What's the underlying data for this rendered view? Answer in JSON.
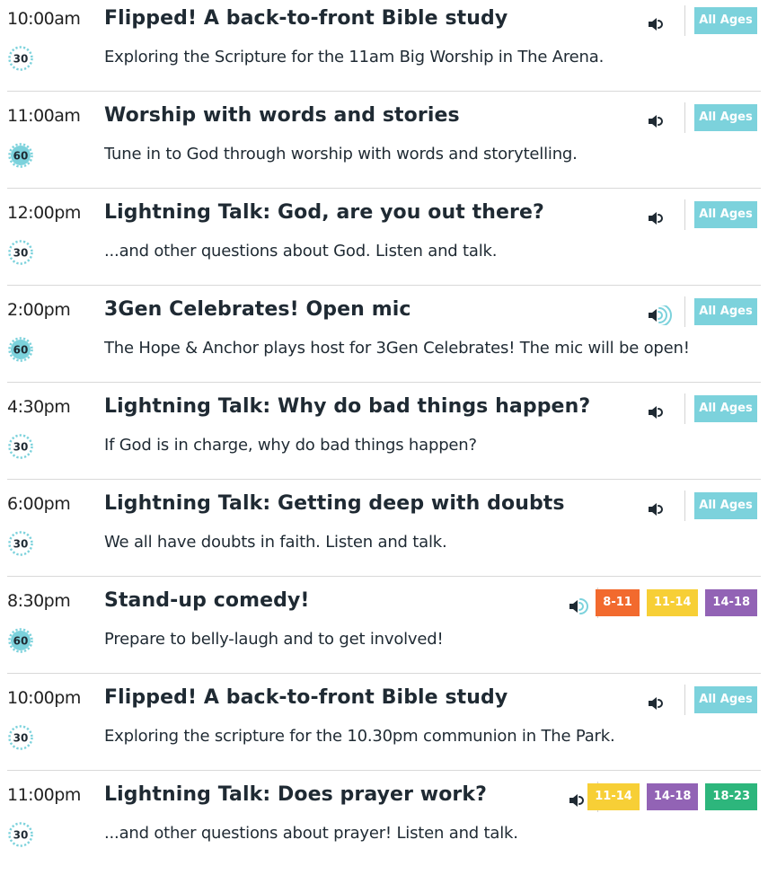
{
  "colors": {
    "all_ages": "#7cd2dc",
    "8-11": "#f26a2e",
    "11-14": "#f7cf36",
    "14-18": "#9263b5",
    "18-23": "#2db67c",
    "duration_badge": "#7cd2dc"
  },
  "events": [
    {
      "time": "10:00am",
      "title": "Flipped! A back-to-front Bible study",
      "description": "Exploring the Scripture for the 11am Big Worship in The Arena.",
      "duration": "30",
      "volume_icon": "volume-low-icon",
      "badges": [
        {
          "label": "All Ages",
          "color": "#7cd2dc"
        }
      ]
    },
    {
      "time": "11:00am",
      "title": "Worship with words and stories",
      "description": "Tune in to God through worship with words and storytelling.",
      "duration": "60",
      "volume_icon": "volume-low-icon",
      "badges": [
        {
          "label": "All Ages",
          "color": "#7cd2dc"
        }
      ]
    },
    {
      "time": "12:00pm",
      "title": "Lightning Talk: God, are you out there?",
      "description": "...and other questions about God. Listen and talk.",
      "duration": "30",
      "volume_icon": "volume-low-icon",
      "badges": [
        {
          "label": "All Ages",
          "color": "#7cd2dc"
        }
      ]
    },
    {
      "time": "2:00pm",
      "title": "3Gen Celebrates! Open mic",
      "description": "The Hope & Anchor plays host for 3Gen Celebrates! The mic will be open!",
      "duration": "60",
      "volume_icon": "volume-high-icon",
      "badges": [
        {
          "label": "All Ages",
          "color": "#7cd2dc"
        }
      ]
    },
    {
      "time": "4:30pm",
      "title": "Lightning Talk: Why do bad things happen?",
      "description": "If God is in charge, why do bad things happen?",
      "duration": "30",
      "volume_icon": "volume-low-icon",
      "badges": [
        {
          "label": "All Ages",
          "color": "#7cd2dc"
        }
      ]
    },
    {
      "time": "6:00pm",
      "title": "Lightning Talk: Getting deep with doubts",
      "description": "We all have doubts in faith. Listen and talk.",
      "duration": "30",
      "volume_icon": "volume-low-icon",
      "badges": [
        {
          "label": "All Ages",
          "color": "#7cd2dc"
        }
      ]
    },
    {
      "time": "8:30pm",
      "title": "Stand-up comedy!",
      "description": "Prepare to belly-laugh and to get involved!",
      "duration": "60",
      "volume_icon": "volume-medium-icon",
      "badges": [
        {
          "label": "8-11",
          "color": "#f26a2e"
        },
        {
          "label": "11-14",
          "color": "#f7cf36"
        },
        {
          "label": "14-18",
          "color": "#9263b5"
        }
      ]
    },
    {
      "time": "10:00pm",
      "title": "Flipped! A back-to-front Bible study",
      "description": "Exploring the scripture for the 10.30pm communion in The Park.",
      "duration": "30",
      "volume_icon": "volume-low-icon",
      "badges": [
        {
          "label": "All Ages",
          "color": "#7cd2dc"
        }
      ]
    },
    {
      "time": "11:00pm",
      "title": "Lightning Talk: Does prayer work?",
      "description": "...and other questions about prayer! Listen and talk.",
      "duration": "30",
      "volume_icon": "volume-low-icon",
      "badges": [
        {
          "label": "11-14",
          "color": "#f7cf36"
        },
        {
          "label": "14-18",
          "color": "#9263b5"
        },
        {
          "label": "18-23",
          "color": "#2db67c"
        }
      ]
    }
  ]
}
